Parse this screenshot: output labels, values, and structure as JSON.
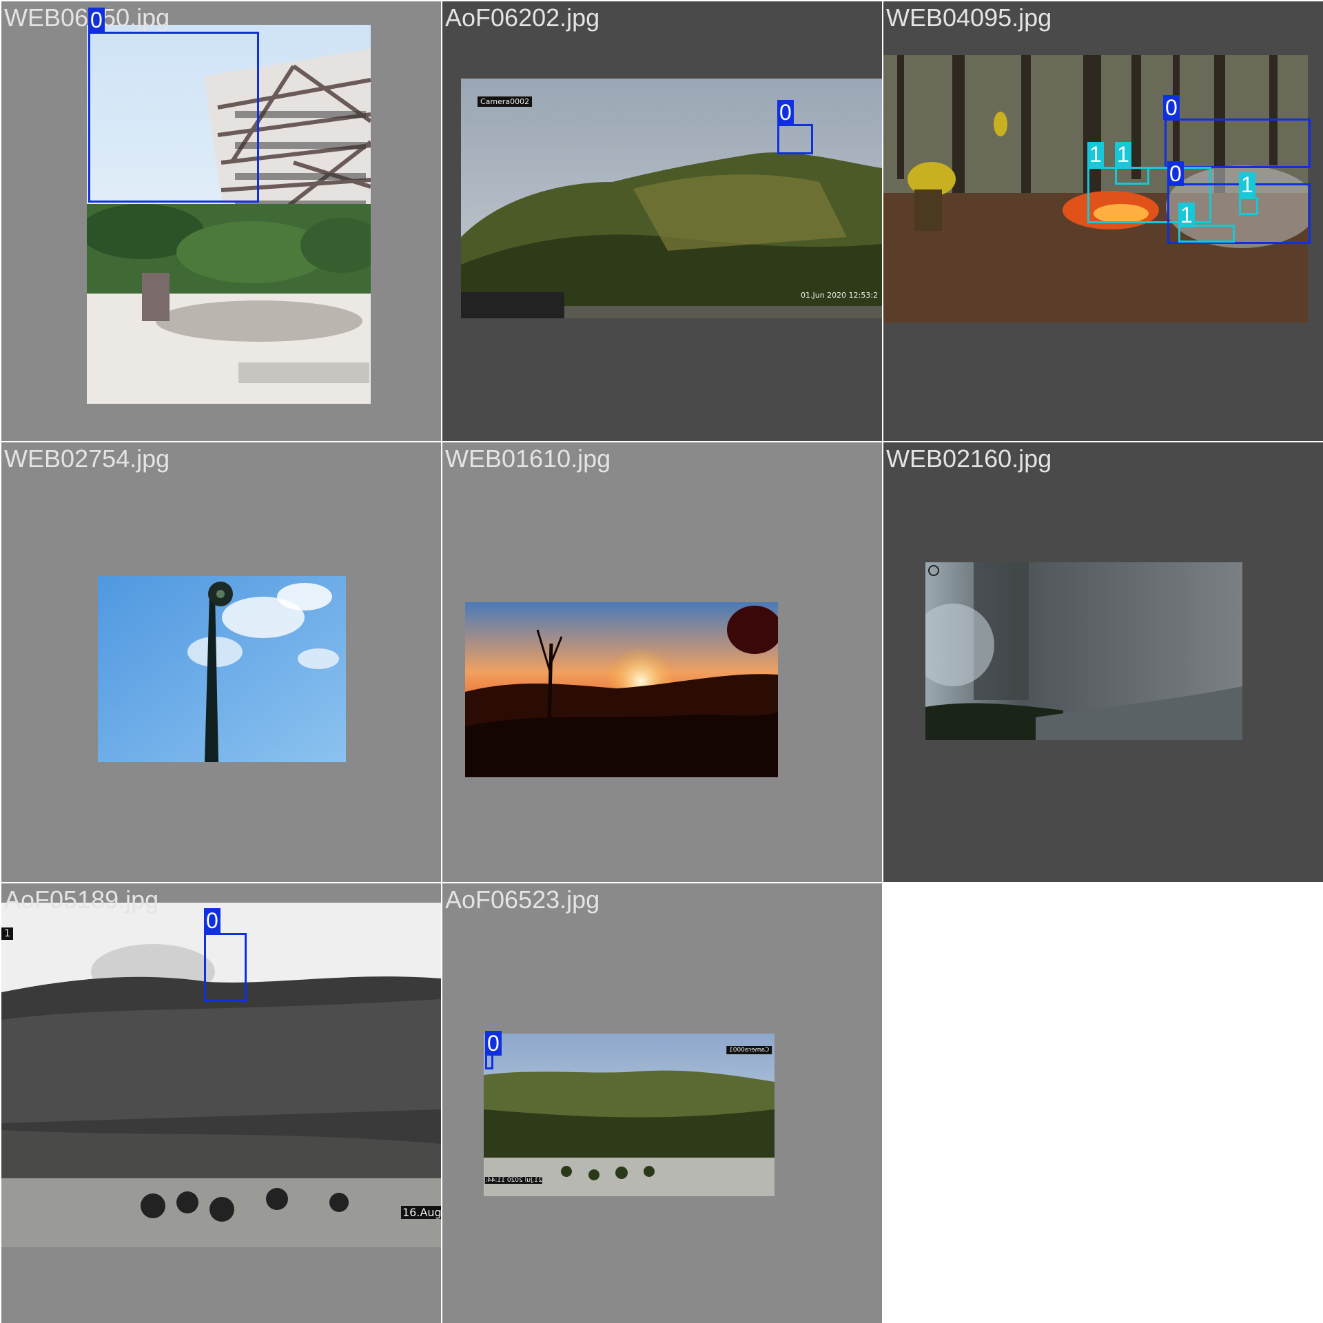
{
  "tiles": [
    {
      "file": "WEB06150.jpg",
      "detections": [
        {
          "cls": "0"
        }
      ]
    },
    {
      "file": "AoF06202.jpg",
      "overlay_camera": "Camera0002",
      "overlay_date": "01.Jun 2020   12:53:2",
      "detections": [
        {
          "cls": "0"
        }
      ]
    },
    {
      "file": "WEB04095.jpg",
      "detections": [
        {
          "cls": "0"
        },
        {
          "cls": "1"
        },
        {
          "cls": "1"
        },
        {
          "cls": "0"
        },
        {
          "cls": "1"
        },
        {
          "cls": "1"
        }
      ]
    },
    {
      "file": "WEB02754.jpg",
      "detections": []
    },
    {
      "file": "WEB01610.jpg",
      "detections": []
    },
    {
      "file": "WEB02160.jpg",
      "detections": []
    },
    {
      "file": "AoF05189.jpg",
      "overlay_corner": "1",
      "overlay_date": "16.Aug",
      "detections": [
        {
          "cls": "0"
        }
      ]
    },
    {
      "file": "AoF06523.jpg",
      "overlay_camera": "Camera0001",
      "overlay_date": "21.Jul 2020  11:44:",
      "detections": [
        {
          "cls": "0"
        }
      ]
    }
  ],
  "colors": {
    "class_0": "#1030e0",
    "class_1": "#16c8d8",
    "tile_light": "#8a8a8a",
    "tile_dark": "#4a4a4a"
  }
}
